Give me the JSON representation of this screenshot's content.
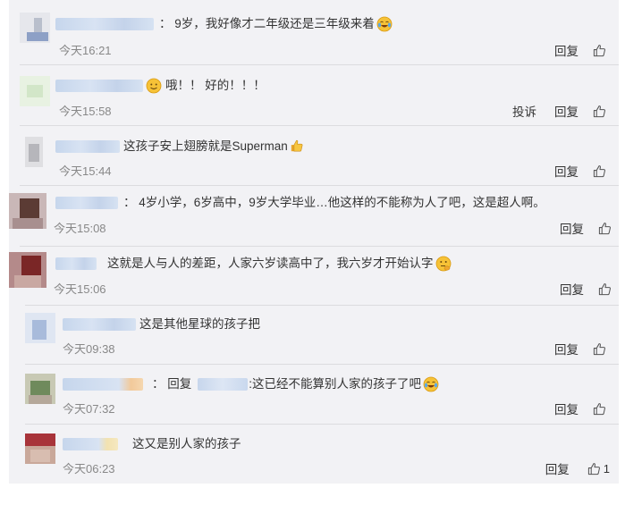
{
  "labels": {
    "reply": "回复",
    "report": "投诉"
  },
  "comments": [
    {
      "text": "：  9岁，我好像才二年级还是三年级来着",
      "time": "今天16:21",
      "emoji": "laugh-cry"
    },
    {
      "text": "哦！！ 好的！！！",
      "time": "今天15:58",
      "emoji_before": "smile",
      "has_report": true
    },
    {
      "text": "这孩子安上翅膀就是Superman",
      "time": "今天15:44",
      "emoji": "thumbs-up"
    },
    {
      "text": "：  4岁小学，6岁高中，9岁大学毕业…他这样的不能称为人了吧，这是超人啊。",
      "time": "今天15:08"
    },
    {
      "text": "这就是人与人的差距，人家六岁读高中了，我六岁才开始认字",
      "time": "今天15:06",
      "emoji": "think"
    },
    {
      "text": "这是其他星球的孩子把",
      "time": "今天09:38",
      "reply": true
    },
    {
      "prefix": "：  回复",
      "text": ":这已经不能算别人家的孩子了吧",
      "time": "今天07:32",
      "reply": true,
      "emoji": "laugh-cry"
    },
    {
      "text": "这又是别人家的孩子",
      "time": "今天06:23",
      "reply": true,
      "like_count": "1"
    }
  ]
}
